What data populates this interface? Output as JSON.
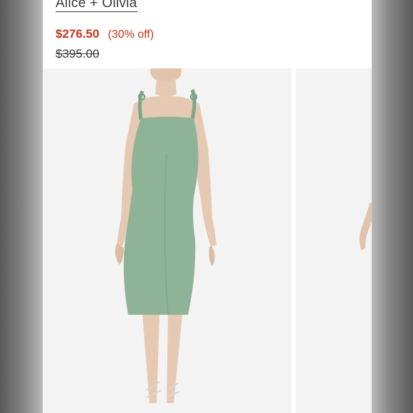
{
  "product": {
    "brand": "Alice + Olivia",
    "sale_price": "$276.50",
    "discount": "(30% off)",
    "original_price": "$395.00"
  },
  "colors": {
    "sale": "#c2371c",
    "dress": "#8fb397",
    "skin": "#e6c9b3",
    "photo_bg": "#f3f3f3"
  },
  "gallery": {
    "images": [
      "product-photo-front",
      "product-photo-next"
    ]
  }
}
